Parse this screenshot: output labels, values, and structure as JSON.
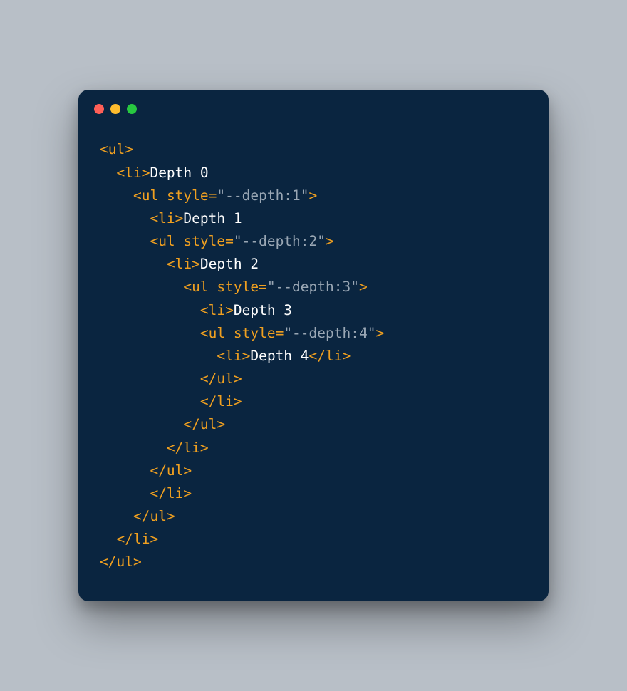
{
  "traffic_light_colors": {
    "red": "#ff5f57",
    "yellow": "#febc2e",
    "green": "#28c840"
  },
  "window_bg": "#0a2540",
  "code": {
    "lines": [
      {
        "indent": 0,
        "tokens": [
          {
            "c": "t",
            "v": "<ul>"
          }
        ]
      },
      {
        "indent": 1,
        "tokens": [
          {
            "c": "t",
            "v": "<li>"
          },
          {
            "c": "txt",
            "v": "Depth 0"
          }
        ]
      },
      {
        "indent": 2,
        "tokens": [
          {
            "c": "t",
            "v": "<ul "
          },
          {
            "c": "a",
            "v": "style"
          },
          {
            "c": "t",
            "v": "="
          },
          {
            "c": "s",
            "v": "\"--depth:1\""
          },
          {
            "c": "t",
            "v": ">"
          }
        ]
      },
      {
        "indent": 3,
        "tokens": [
          {
            "c": "t",
            "v": "<li>"
          },
          {
            "c": "txt",
            "v": "Depth 1"
          }
        ]
      },
      {
        "indent": 3,
        "tokens": [
          {
            "c": "t",
            "v": "<ul "
          },
          {
            "c": "a",
            "v": "style"
          },
          {
            "c": "t",
            "v": "="
          },
          {
            "c": "s",
            "v": "\"--depth:2\""
          },
          {
            "c": "t",
            "v": ">"
          }
        ]
      },
      {
        "indent": 4,
        "tokens": [
          {
            "c": "t",
            "v": "<li>"
          },
          {
            "c": "txt",
            "v": "Depth 2"
          }
        ]
      },
      {
        "indent": 5,
        "tokens": [
          {
            "c": "t",
            "v": "<ul "
          },
          {
            "c": "a",
            "v": "style"
          },
          {
            "c": "t",
            "v": "="
          },
          {
            "c": "s",
            "v": "\"--depth:3\""
          },
          {
            "c": "t",
            "v": ">"
          }
        ]
      },
      {
        "indent": 6,
        "tokens": [
          {
            "c": "t",
            "v": "<li>"
          },
          {
            "c": "txt",
            "v": "Depth 3"
          }
        ]
      },
      {
        "indent": 6,
        "tokens": [
          {
            "c": "t",
            "v": "<ul "
          },
          {
            "c": "a",
            "v": "style"
          },
          {
            "c": "t",
            "v": "="
          },
          {
            "c": "s",
            "v": "\"--depth:4\""
          },
          {
            "c": "t",
            "v": ">"
          }
        ]
      },
      {
        "indent": 7,
        "tokens": [
          {
            "c": "t",
            "v": "<li>"
          },
          {
            "c": "txt",
            "v": "Depth 4"
          },
          {
            "c": "t",
            "v": "</li>"
          }
        ]
      },
      {
        "indent": 6,
        "tokens": [
          {
            "c": "t",
            "v": "</ul>"
          }
        ]
      },
      {
        "indent": 6,
        "tokens": [
          {
            "c": "t",
            "v": "</li>"
          }
        ]
      },
      {
        "indent": 5,
        "tokens": [
          {
            "c": "t",
            "v": "</ul>"
          }
        ]
      },
      {
        "indent": 4,
        "tokens": [
          {
            "c": "t",
            "v": "</li>"
          }
        ]
      },
      {
        "indent": 3,
        "tokens": [
          {
            "c": "t",
            "v": "</ul>"
          }
        ]
      },
      {
        "indent": 3,
        "tokens": [
          {
            "c": "t",
            "v": "</li>"
          }
        ]
      },
      {
        "indent": 2,
        "tokens": [
          {
            "c": "t",
            "v": "</ul>"
          }
        ]
      },
      {
        "indent": 1,
        "tokens": [
          {
            "c": "t",
            "v": "</li>"
          }
        ]
      },
      {
        "indent": 0,
        "tokens": [
          {
            "c": "t",
            "v": "</ul>"
          }
        ]
      }
    ]
  }
}
